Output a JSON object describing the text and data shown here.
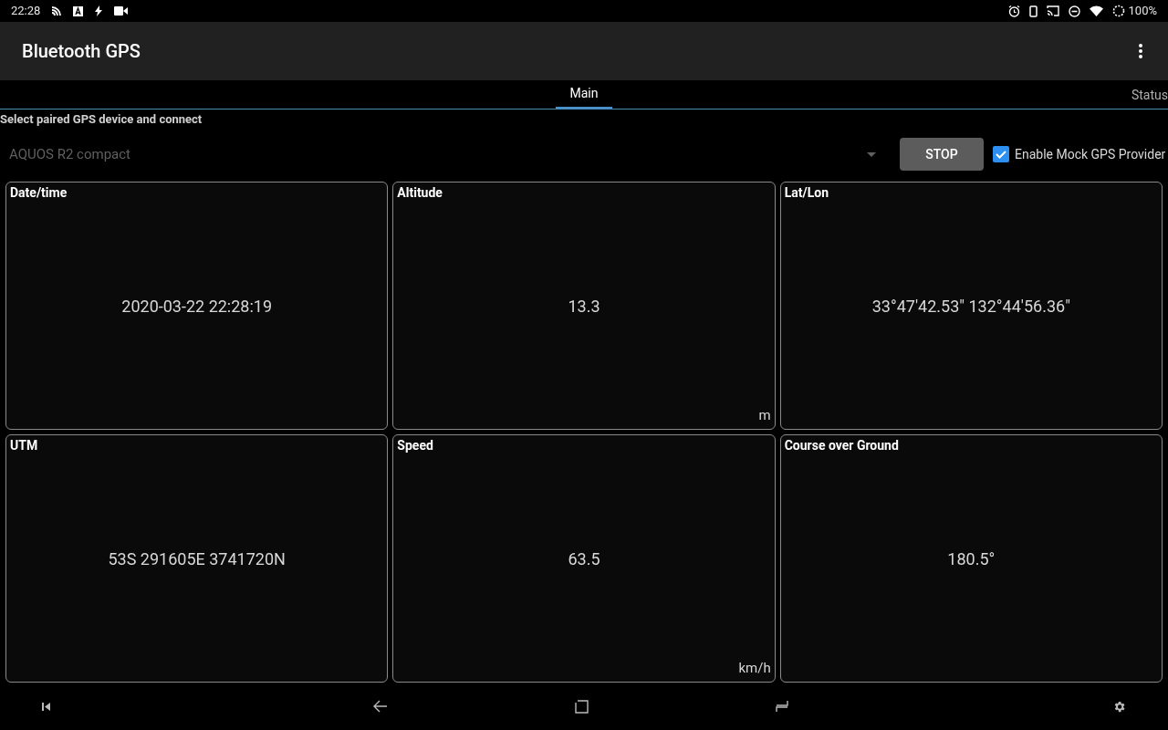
{
  "status_bar": {
    "time": "22:28",
    "battery": "100%"
  },
  "app_bar": {
    "title": "Bluetooth GPS"
  },
  "tabs": [
    {
      "label": "Main",
      "selected": true
    },
    {
      "label": "Status",
      "selected": false
    }
  ],
  "device_section": {
    "label": "Select paired GPS device and connect",
    "device": "AQUOS R2 compact",
    "button": "STOP",
    "mock_provider": {
      "label": "Enable Mock GPS Provider",
      "checked": true
    }
  },
  "tiles": [
    {
      "title": "Date/time",
      "value": "2020-03-22 22:28:19"
    },
    {
      "title": "Altitude",
      "value": "13.3",
      "unit": "m"
    },
    {
      "title": "Lat/Lon",
      "value": "33°47'42.53\" 132°44'56.36\""
    },
    {
      "title": "UTM",
      "value": "53S 291605E 3741720N"
    },
    {
      "title": "Speed",
      "value": "63.5",
      "unit": "km/h"
    },
    {
      "title": "Course over Ground",
      "value": "180.5°"
    }
  ]
}
